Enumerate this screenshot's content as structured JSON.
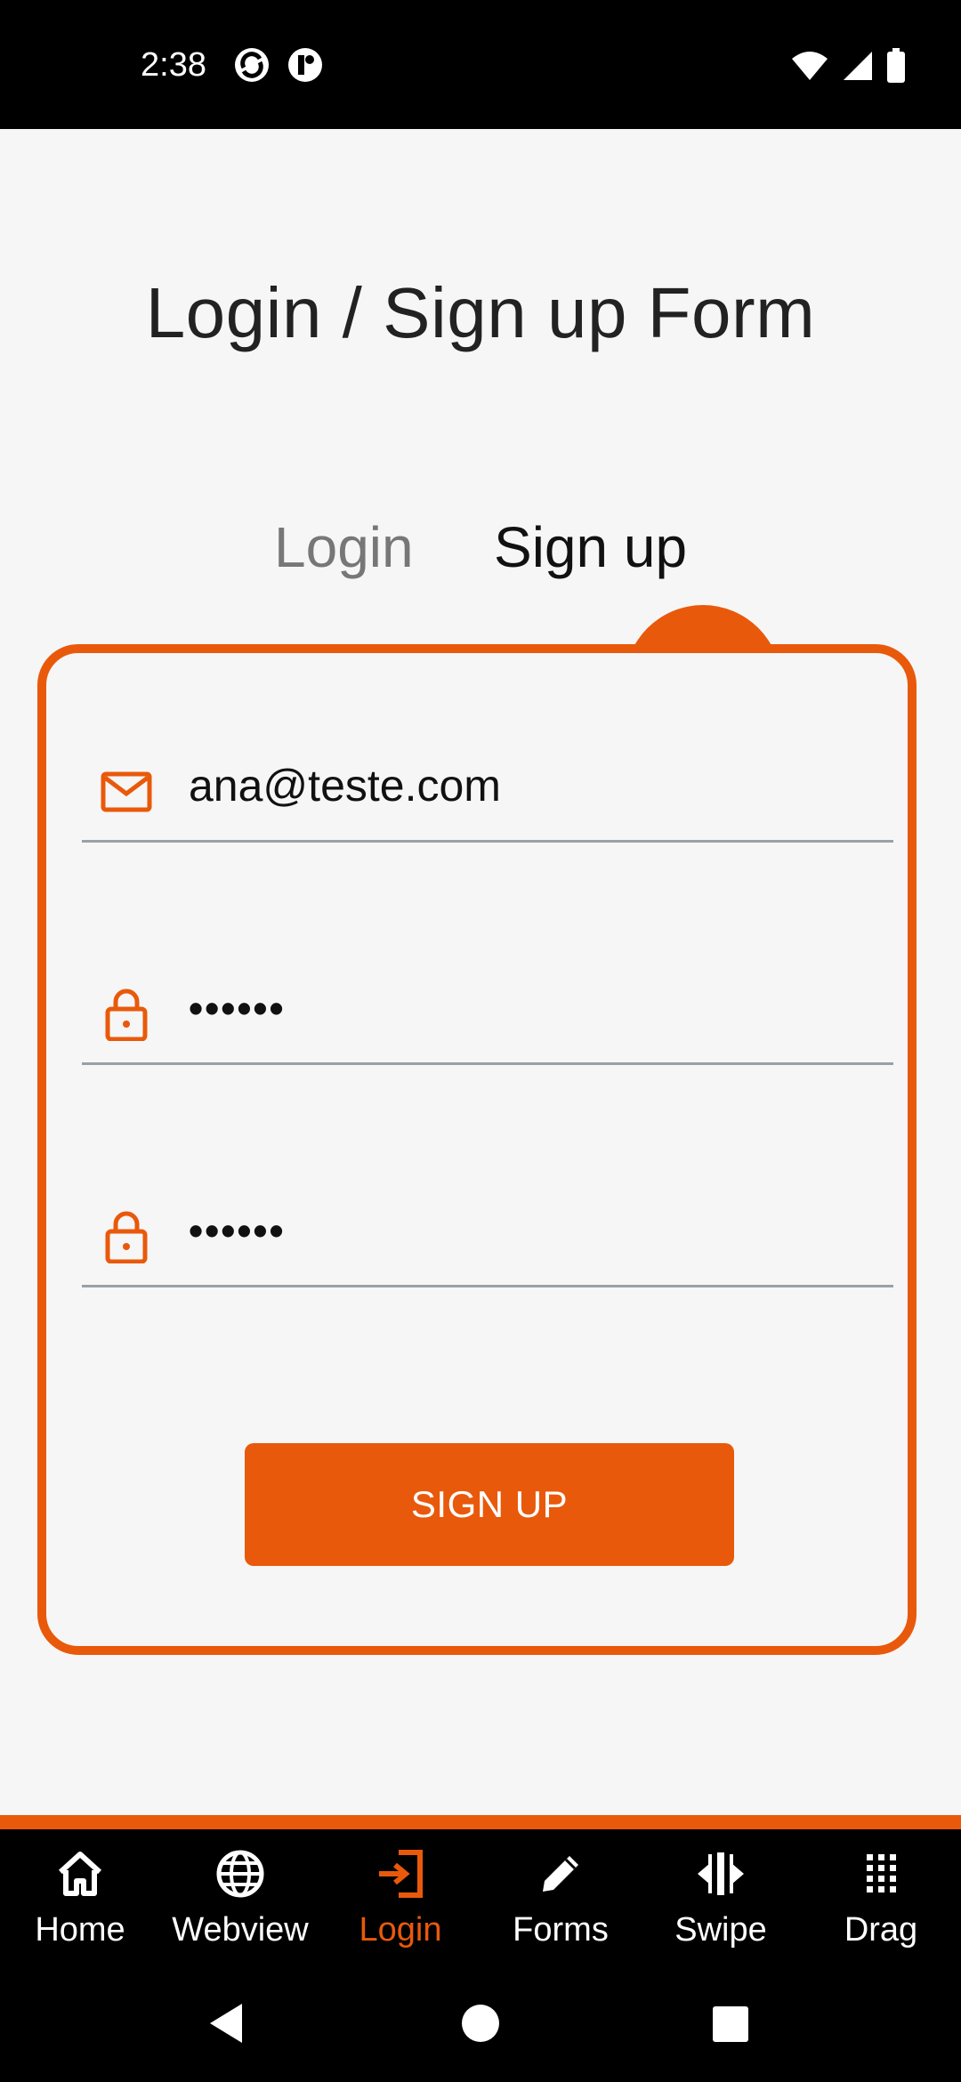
{
  "status_bar": {
    "time": "2:38",
    "icons": [
      "app-notification-icon",
      "app-notification-icon",
      "wifi-icon",
      "signal-icon",
      "battery-icon"
    ]
  },
  "page": {
    "title": "Login / Sign up Form"
  },
  "tabs": [
    {
      "label": "Login",
      "selected": false
    },
    {
      "label": "Sign up",
      "selected": true
    }
  ],
  "form": {
    "email": {
      "value": "ana@teste.com",
      "icon": "mail-icon"
    },
    "password": {
      "value": "••••••",
      "icon": "lock-icon"
    },
    "repeat_password": {
      "value": "••••••",
      "icon": "lock-icon"
    },
    "submit_label": "SIGN UP"
  },
  "bottom_nav": {
    "items": [
      {
        "label": "Home",
        "icon": "home-icon",
        "active": false
      },
      {
        "label": "Webview",
        "icon": "globe-icon",
        "active": false
      },
      {
        "label": "Login",
        "icon": "login-icon",
        "active": true
      },
      {
        "label": "Forms",
        "icon": "pencil-icon",
        "active": false
      },
      {
        "label": "Swipe",
        "icon": "swipe-icon",
        "active": false
      },
      {
        "label": "Drag",
        "icon": "drag-grid-icon",
        "active": false
      }
    ]
  },
  "colors": {
    "accent": "#e9590b",
    "background": "#f6f6f6",
    "bar": "#000000"
  }
}
